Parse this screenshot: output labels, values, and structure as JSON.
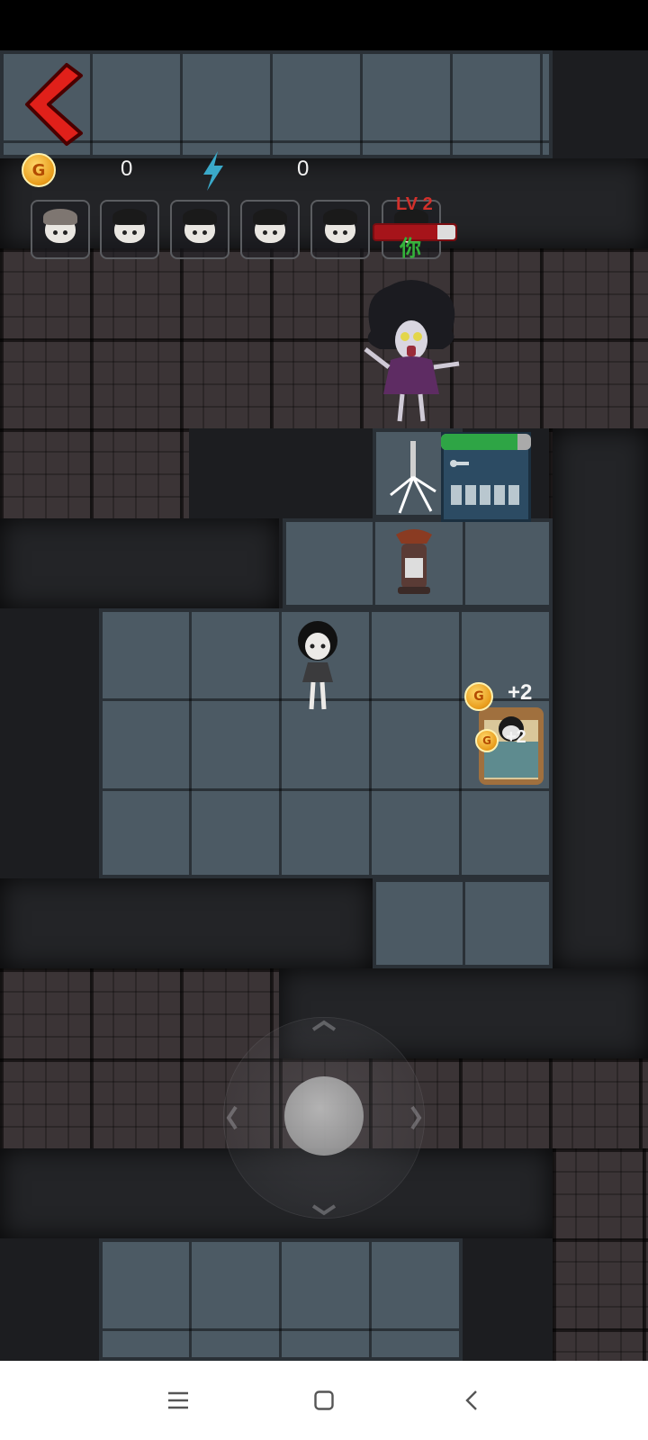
{
  "hud": {
    "coins": "0",
    "energy": "0",
    "coin_symbol": "G",
    "accent_coin": "#e89b1a",
    "energy_color": "#3aa9c9"
  },
  "players": [
    {
      "name": "player-1",
      "hair": "light"
    },
    {
      "name": "player-2",
      "hair": "dark"
    },
    {
      "name": "player-3",
      "hair": "dark"
    },
    {
      "name": "player-4",
      "hair": "dark"
    },
    {
      "name": "player-5",
      "hair": "dark"
    },
    {
      "name": "player-you",
      "hair": "dark",
      "level_label": "LV 2",
      "you_label": "你"
    }
  ],
  "door": {
    "health": 0.85,
    "health_color": "#2ea545"
  },
  "rewards": [
    {
      "text": "+2"
    },
    {
      "text": "+2"
    }
  ],
  "nav": {
    "menu_icon": "menu-icon",
    "home_icon": "home-icon",
    "back_icon": "back-icon"
  }
}
